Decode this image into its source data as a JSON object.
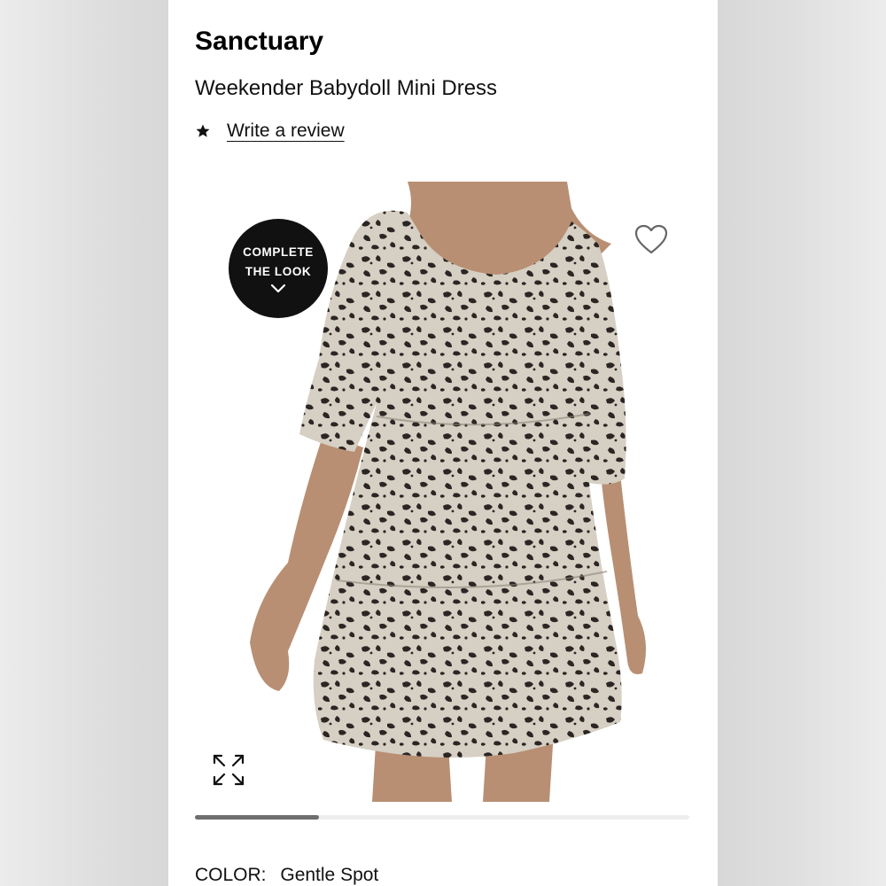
{
  "product": {
    "brand": "Sanctuary",
    "name": "Weekender Babydoll Mini Dress",
    "review_link": "Write a review"
  },
  "image": {
    "badge_line1": "COMPLETE",
    "badge_line2": "THE LOOK",
    "carousel_progress": 0.25
  },
  "color": {
    "label": "COLOR:",
    "value": "Gentle Spot"
  },
  "icons": [
    "star-icon",
    "heart-icon",
    "chevron-down-icon",
    "expand-icon"
  ]
}
